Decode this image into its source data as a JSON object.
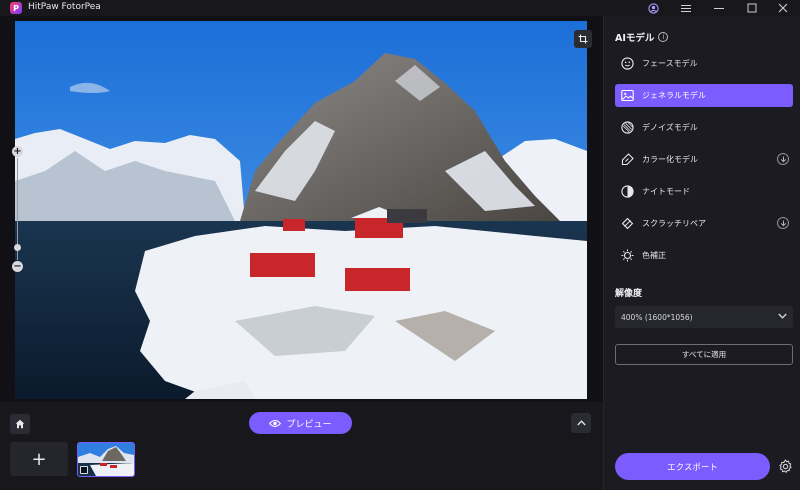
{
  "app": {
    "title": "HitPaw FotorPea",
    "logo_letter": "P"
  },
  "window_controls": {
    "account_icon": "account-icon",
    "menu_icon": "menu-icon",
    "minimize_icon": "minimize-icon",
    "maximize_icon": "maximize-icon",
    "close_icon": "close-icon"
  },
  "canvas": {
    "zoom_plus": "+",
    "zoom_minus": "−",
    "zoom_level_fraction": 0.88
  },
  "bottom": {
    "preview_label": "プレビュー",
    "add_label": "+"
  },
  "panel": {
    "header": "AIモデル",
    "info_glyph": "i",
    "models": [
      {
        "label": "フェースモデル",
        "icon": "face-icon",
        "active": false,
        "download": false
      },
      {
        "label": "ジェネラルモデル",
        "icon": "image-icon",
        "active": true,
        "download": false
      },
      {
        "label": "デノイズモデル",
        "icon": "denoise-icon",
        "active": false,
        "download": false
      },
      {
        "label": "カラー化モデル",
        "icon": "colorize-icon",
        "active": false,
        "download": true
      },
      {
        "label": "ナイトモード",
        "icon": "night-mode-icon",
        "active": false,
        "download": false
      },
      {
        "label": "スクラッチリペア",
        "icon": "scratch-repair-icon",
        "active": false,
        "download": true
      },
      {
        "label": "色補正",
        "icon": "color-correction-icon",
        "active": false,
        "download": false
      }
    ],
    "resolution_label": "解像度",
    "resolution_value": "400% (1600*1056)",
    "apply_all_label": "すべてに適用",
    "export_label": "エクスポート"
  },
  "colors": {
    "accent": "#7b5cff",
    "background": "#17171c",
    "panel": "#1b1b21"
  }
}
